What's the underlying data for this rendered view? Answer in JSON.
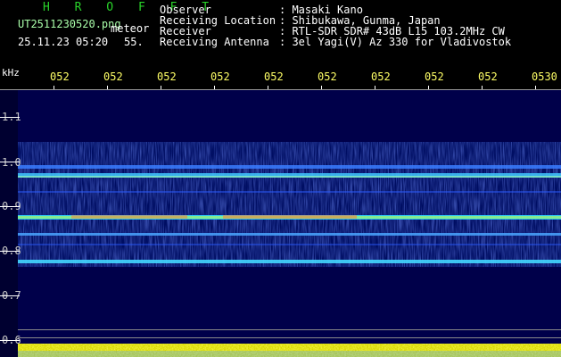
{
  "header": {
    "program": "H R O F F T",
    "filename": "UT2511230520.png",
    "mode": "meteor",
    "datetime": "25.11.23 05:20",
    "frame": "55.",
    "fields": [
      {
        "label": "Observer",
        "value": ": Masaki Kano"
      },
      {
        "label": "Receiving Location",
        "value": ": Shibukawa, Gunma, Japan"
      },
      {
        "label": "Receiver",
        "value": ": RTL-SDR SDR# 43dB L15 103.2MHz CW"
      },
      {
        "label": "Receiving Antenna",
        "value": ": 3el Yagi(V) Az 330 for Vladivostok"
      }
    ]
  },
  "axis": {
    "unit": "kHz",
    "x_ticks": [
      "052",
      "052",
      "052",
      "052",
      "052",
      "052",
      "052",
      "052",
      "052",
      "0530"
    ],
    "y_ticks": [
      "1.1",
      "1.0",
      "0.9",
      "0.8",
      "0.7",
      "0.6"
    ]
  },
  "colors": {
    "background": "#00004a",
    "header_text": "#ffffff",
    "program_text": "#29d32a",
    "x_labels": "#ffff66"
  }
}
